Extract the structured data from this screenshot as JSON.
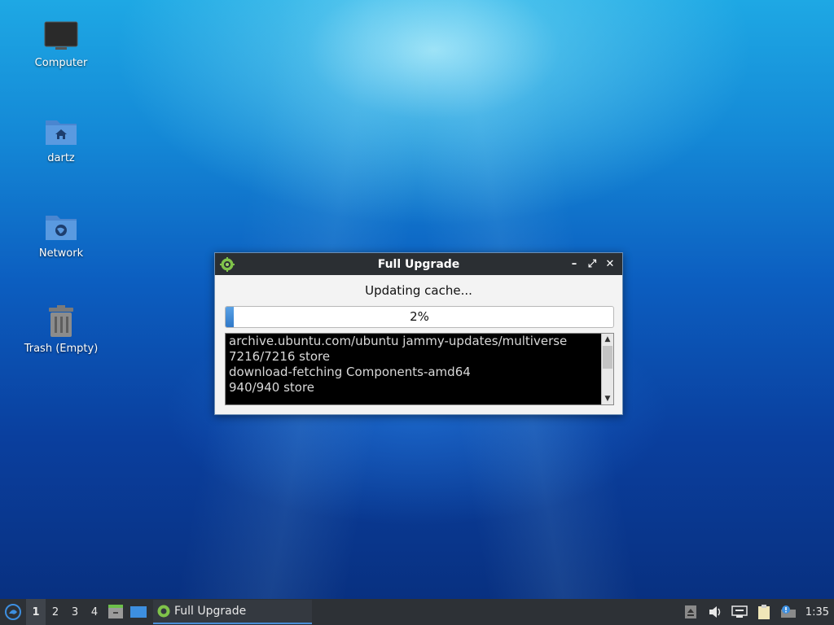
{
  "desktop": {
    "icons": [
      {
        "label": "Computer",
        "icon": "computer-icon"
      },
      {
        "label": "dartz",
        "icon": "home-folder-icon"
      },
      {
        "label": "Network",
        "icon": "network-folder-icon"
      },
      {
        "label": "Trash (Empty)",
        "icon": "trash-icon"
      }
    ]
  },
  "window": {
    "title": "Full Upgrade",
    "status": "Updating cache...",
    "progress": {
      "percent_label": "2%",
      "value": 0.02
    },
    "log_lines": [
      "archive.ubuntu.com/ubuntu jammy-updates/multiverse",
      "7216/7216 store",
      "download-fetching Components-amd64",
      "940/940 store"
    ],
    "controls": {
      "minimize": "–",
      "maximize": "⤢",
      "close": "✕"
    }
  },
  "taskbar": {
    "workspaces": [
      "1",
      "2",
      "3",
      "4"
    ],
    "active_workspace": "1",
    "task_label": "Full Upgrade",
    "clock": "1:35"
  },
  "colors": {
    "accent": "#4a8fd8",
    "titlebar": "#2b2f33",
    "taskbar": "#2d3136"
  }
}
